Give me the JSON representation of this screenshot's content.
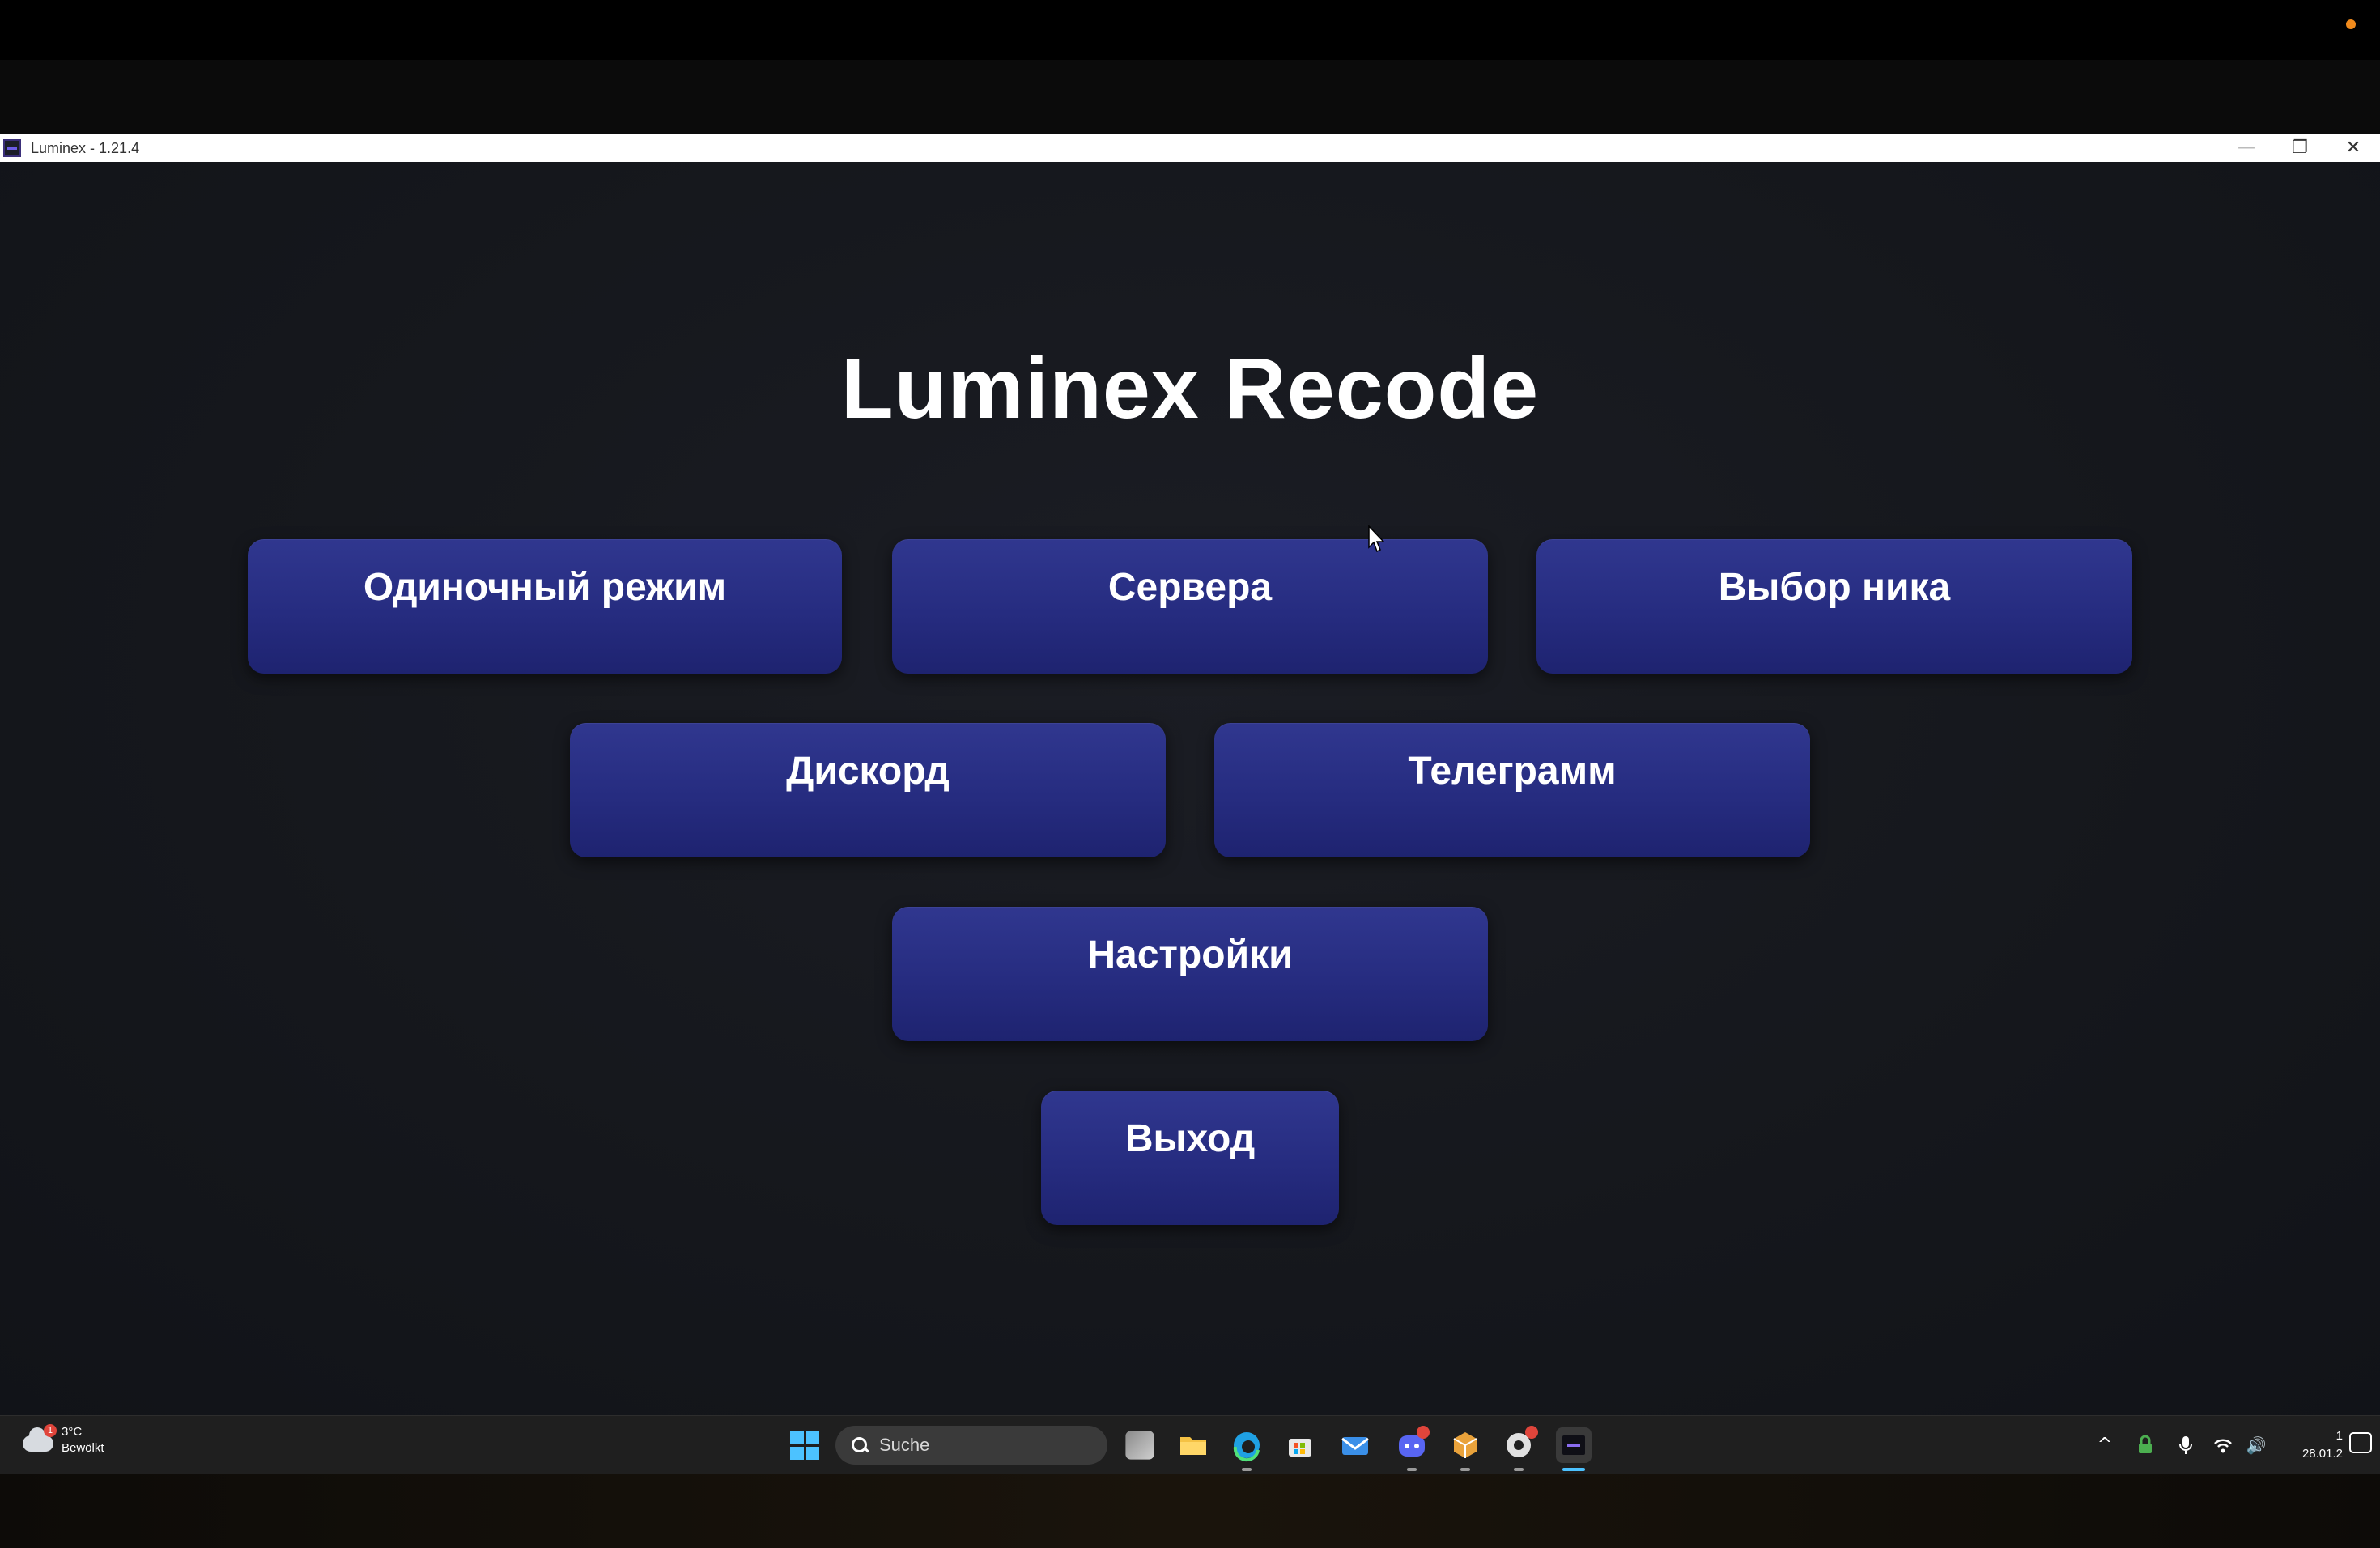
{
  "window": {
    "title": "Luminex - 1.21.4",
    "min_glyph": "—",
    "max_glyph": "❐",
    "close_glyph": "✕"
  },
  "app": {
    "title": "Luminex Recode",
    "buttons": {
      "singleplayer": "Одиночный режим",
      "servers": "Сервера",
      "nickname": "Выбор ника",
      "discord": "Дискорд",
      "telegram": "Телеграмм",
      "settings": "Настройки",
      "exit": "Выход"
    }
  },
  "taskbar": {
    "weather": {
      "temp": "3°C",
      "condition": "Bewölkt",
      "badge": "1"
    },
    "search_placeholder": "Suche",
    "tray": {
      "chevron": "^",
      "volume": "🔊"
    },
    "clock": {
      "time": "1",
      "date": "28.01.2"
    }
  },
  "colors": {
    "button_bg": "#262c80",
    "window_bg": "#15171c",
    "taskbar_bg": "#1f1f1f",
    "accent": "#4cc2ff"
  }
}
